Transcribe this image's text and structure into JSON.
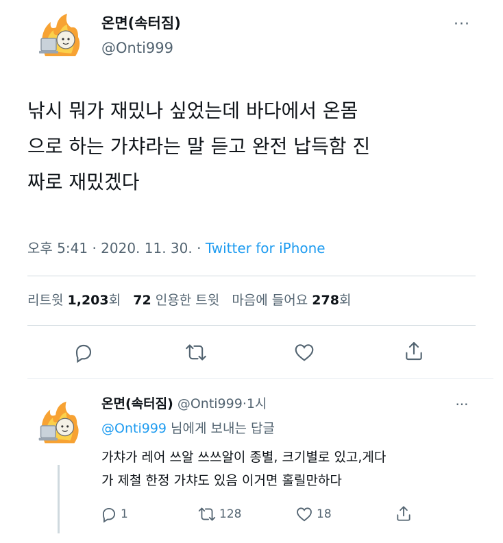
{
  "main_tweet": {
    "display_name": "온면(속터짐)",
    "handle": "@Onti999",
    "text_lines": [
      "낚시 뭐가 재밌나 싶었는데 바다에서 온몸",
      "으로 하는 가챠라는 말 듣고 완전 납득함 진",
      "짜로 재밌겠다"
    ],
    "time": "오후 5:41",
    "sep1": "·",
    "date": "2020. 11. 30.",
    "sep2": "·",
    "source": "Twitter for iPhone",
    "stats": {
      "retweets_label": "리트윗",
      "retweets": "1,203",
      "retweets_unit": "회",
      "quotes": "72",
      "quotes_label": "인용한 트윗",
      "likes_label": "마음에 들어요",
      "likes": "278",
      "likes_unit": "회"
    },
    "more": "···"
  },
  "reply": {
    "display_name": "온면(속터짐)",
    "handle": "@Onti999",
    "time_sep": "·",
    "time": "1시",
    "replying_to_handle": "@Onti999",
    "replying_to_suffix": "님에게 보내는 답글",
    "text_lines": [
      "가챠가 레어 쓰알 쓰쓰알이 종별, 크기별로 있고,게다",
      "가 제철 한정 가챠도 있음 이거면 홀릴만하다"
    ],
    "replies": "1",
    "retweets": "128",
    "likes": "18",
    "more": "···"
  },
  "colors": {
    "accent": "#1d9bf0",
    "muted": "#536471",
    "text": "#0f1419",
    "divider": "#cfd9de"
  },
  "icons": [
    "reply-icon",
    "retweet-icon",
    "like-icon",
    "share-icon",
    "more-icon"
  ]
}
